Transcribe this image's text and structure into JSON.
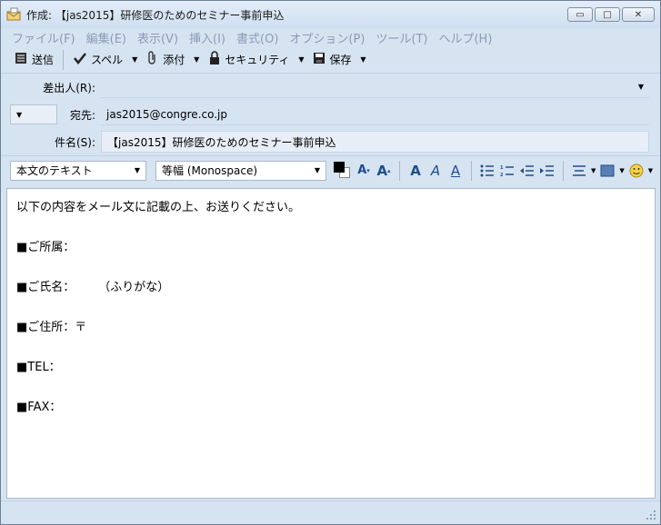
{
  "window": {
    "title": "作成: 【jas2015】研修医のためのセミナー事前申込",
    "minimize": "▭",
    "maximize": "□",
    "close": "✕"
  },
  "menu": [
    "ファイル(F)",
    "編集(E)",
    "表示(V)",
    "挿入(I)",
    "書式(O)",
    "オプション(P)",
    "ツール(T)",
    "ヘルプ(H)"
  ],
  "toolbar": {
    "send_label": "送信",
    "spell_label": "スペル",
    "attach_label": "添付",
    "security_label": "セキュリティ",
    "save_label": "保存"
  },
  "header": {
    "from_label": "差出人(R):",
    "from_value": "",
    "to_label": "宛先:",
    "to_value": "jas2015@congre.co.jp",
    "subject_label": "件名(S):",
    "subject_value": "【jas2015】研修医のためのセミナー事前申込"
  },
  "format": {
    "paragraph_style": "本文のテキスト",
    "font": "等幅 (Monospace)"
  },
  "body": {
    "lines": [
      "以下の内容をメール文に記載の上、お送りください。",
      "",
      "■ご所属：",
      "",
      "■ご氏名：　　　（ふりがな）",
      "",
      "■ご住所：〒",
      "",
      "■TEL：",
      "",
      "■FAX："
    ]
  },
  "colors": {
    "accent": "#1f4e8c",
    "menu_text": "#8c9cb5",
    "window_bg": "#d6e3f1"
  }
}
